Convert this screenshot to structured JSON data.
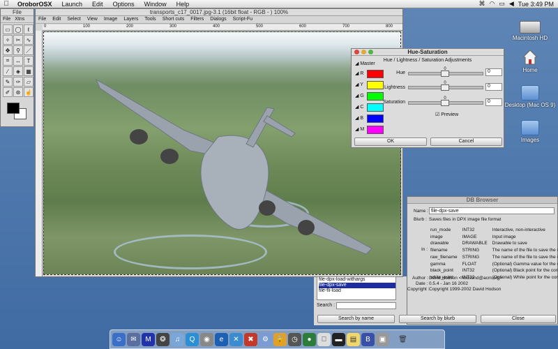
{
  "menubar": {
    "app_name": "OroborOSX",
    "items": [
      "Launch",
      "Edit",
      "Options",
      "Window",
      "Help"
    ],
    "clock": "Tue 3:49 PM"
  },
  "desktop": {
    "icons": [
      "Macintosh HD",
      "Home",
      "Desktop (Mac OS 9)",
      "Images"
    ]
  },
  "toolbox": {
    "title": "File",
    "menu": [
      "File",
      "Xtns"
    ]
  },
  "image_window": {
    "title": "transports_c17_0017.jpg-3.1 (16bit float - RGB - ) 100%",
    "menu": [
      "File",
      "Edit",
      "Select",
      "View",
      "Image",
      "Layers",
      "Tools",
      "Short cuts",
      "Filters",
      "Dialogs",
      "Script-Fu"
    ],
    "ruler": [
      "0",
      "100",
      "200",
      "300",
      "400",
      "500",
      "600",
      "700",
      "800"
    ]
  },
  "hue_saturation": {
    "title": "Hue-Saturation",
    "subtitle": "Hue / Lightness / Saturation Adjustments",
    "master_label": "Master",
    "channels": [
      {
        "label": "R",
        "color": "#ff0000"
      },
      {
        "label": "Y",
        "color": "#ffff00"
      },
      {
        "label": "G",
        "color": "#00ff00"
      },
      {
        "label": "C",
        "color": "#00ffff"
      },
      {
        "label": "B",
        "color": "#0000ff"
      },
      {
        "label": "M",
        "color": "#ff00ff"
      }
    ],
    "hue_label": "Hue",
    "hue_value": "0",
    "lightness_label": "Lightness",
    "lightness_value": "0",
    "saturation_label": "Saturation",
    "saturation_value": "0",
    "preview_label": "Preview",
    "ok_label": "OK",
    "cancel_label": "Cancel"
  },
  "db_browser": {
    "title": "DB Browser",
    "name_label": "Name :",
    "name_value": "file-dpx-save",
    "blurb_label": "Blurb :",
    "blurb_value": "Saves files in DPX image file format",
    "in_label": "In :",
    "params": [
      {
        "name": "run_mode",
        "type": "INT32",
        "desc": "Interactive, non-interactive"
      },
      {
        "name": "image",
        "type": "IMAGE",
        "desc": "Input image"
      },
      {
        "name": "drawable",
        "type": "DRAWABLE",
        "desc": "Drawable to save"
      },
      {
        "name": "filename",
        "type": "STRING",
        "desc": "The name of the file to save the image in"
      },
      {
        "name": "raw_filename",
        "type": "STRING",
        "desc": "The name of the file to save the image in"
      },
      {
        "name": "gamma",
        "type": "FLOAT",
        "desc": "(Optional) Gamma value for the conversio"
      },
      {
        "name": "black_point",
        "type": "INT32",
        "desc": "(Optional) Black point for the conversion"
      },
      {
        "name": "white_point",
        "type": "INT32",
        "desc": "(Optional) White point for the conversion"
      }
    ],
    "author_label": "Author :",
    "author_value": "David Hodson <hodsond@acm.org>",
    "date_label": "Date :",
    "date_value": "0.5.4 - Jan 16 2002",
    "copyright_label": "Copyright :",
    "copyright_value": "Copyright 1999-2002 David Hodson",
    "proc_list": [
      "file-dpx-load-withargs",
      "file-dpx-save",
      "file-fli-load"
    ],
    "search_label": "Search :",
    "search_by_name": "Search by name",
    "search_by_blurb": "Search by blurb",
    "close_label": "Close"
  }
}
